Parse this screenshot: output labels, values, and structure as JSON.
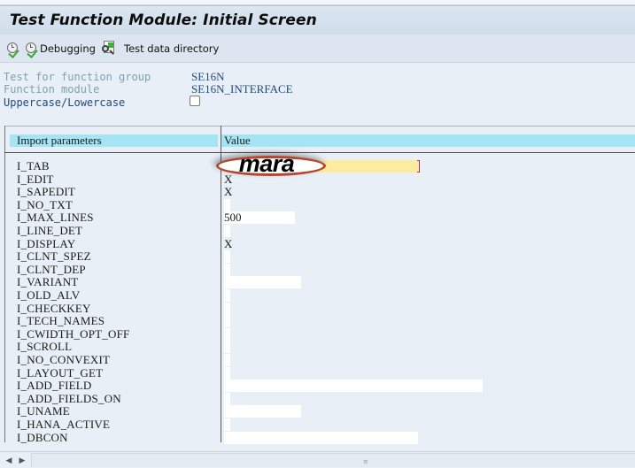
{
  "window": {
    "title": "Test Function Module: Initial Screen"
  },
  "toolbar": {
    "execute_icon": "execute-icon",
    "debugging_label": "Debugging",
    "test_data_directory_label": "Test data directory"
  },
  "header_fields": [
    {
      "label": "Test for function group",
      "value": "SE16N"
    },
    {
      "label": "Function module",
      "value": "SE16N_INTERFACE"
    },
    {
      "label": "Uppercase/Lowercase",
      "checked": false
    }
  ],
  "table": {
    "columns": [
      "Import parameters",
      "Value"
    ],
    "rows": [
      {
        "name": "I_TAB",
        "value": "mara",
        "required": true
      },
      {
        "name": "I_EDIT",
        "value": "X"
      },
      {
        "name": "I_SAPEDIT",
        "value": "X"
      },
      {
        "name": "I_NO_TXT",
        "value": ""
      },
      {
        "name": "I_MAX_LINES",
        "value": "500"
      },
      {
        "name": "I_LINE_DET",
        "value": ""
      },
      {
        "name": "I_DISPLAY",
        "value": "X"
      },
      {
        "name": "I_CLNT_SPEZ",
        "value": ""
      },
      {
        "name": "I_CLNT_DEP",
        "value": ""
      },
      {
        "name": "I_VARIANT",
        "value": ""
      },
      {
        "name": "I_OLD_ALV",
        "value": ""
      },
      {
        "name": "I_CHECKKEY",
        "value": ""
      },
      {
        "name": "I_TECH_NAMES",
        "value": ""
      },
      {
        "name": "I_CWIDTH_OPT_OFF",
        "value": ""
      },
      {
        "name": "I_SCROLL",
        "value": ""
      },
      {
        "name": "I_NO_CONVEXIT",
        "value": ""
      },
      {
        "name": "I_LAYOUT_GET",
        "value": ""
      },
      {
        "name": "I_ADD_FIELD",
        "value": ""
      },
      {
        "name": "I_ADD_FIELDS_ON",
        "value": ""
      },
      {
        "name": "I_UNAME",
        "value": ""
      },
      {
        "name": "I_HANA_ACTIVE",
        "value": ""
      },
      {
        "name": "I_DBCON",
        "value": ""
      }
    ]
  },
  "annotation": {
    "text": "mara",
    "color": "#b5452b"
  },
  "colors": {
    "header_band": "#a5e4f3",
    "required_field": "#fdec9f",
    "required_marker": "#d9271c"
  }
}
